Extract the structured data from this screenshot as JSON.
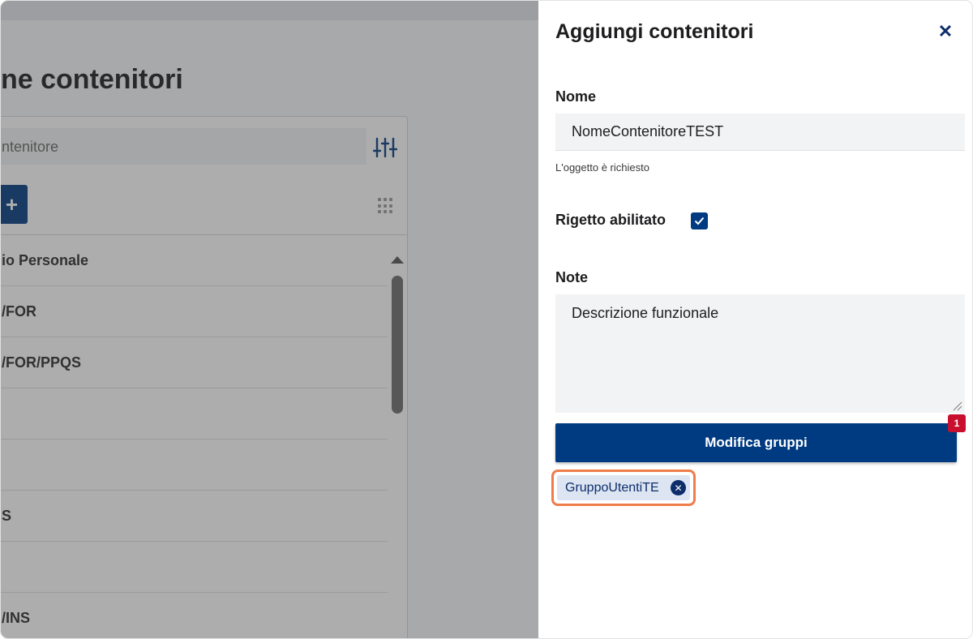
{
  "background": {
    "page_title": "ne contenitori",
    "search_placeholder": "ntenitore",
    "add_button_label": "+",
    "list_items": [
      "io Personale",
      "/FOR",
      "/FOR/PPQS",
      "",
      "",
      "S",
      "",
      "/INS"
    ]
  },
  "drawer": {
    "title": "Aggiungi contenitori",
    "close_label": "✕",
    "name_label": "Nome",
    "name_value": "NomeContenitoreTEST",
    "name_helper": "L'oggetto è richiesto",
    "enabled_label": "Rigetto abilitato",
    "enabled_checked": true,
    "note_label": "Note",
    "note_value": "Descrizione funzionale",
    "edit_groups_button": "Modifica gruppi",
    "groups_badge": "1",
    "group_chips": [
      "GruppoUtentiTE"
    ],
    "chip_remove_label": "✕"
  },
  "colors": {
    "primary": "#003a80",
    "badge": "#c8102e",
    "highlight": "#ef7d4a",
    "chip_bg": "#dde5f2"
  }
}
